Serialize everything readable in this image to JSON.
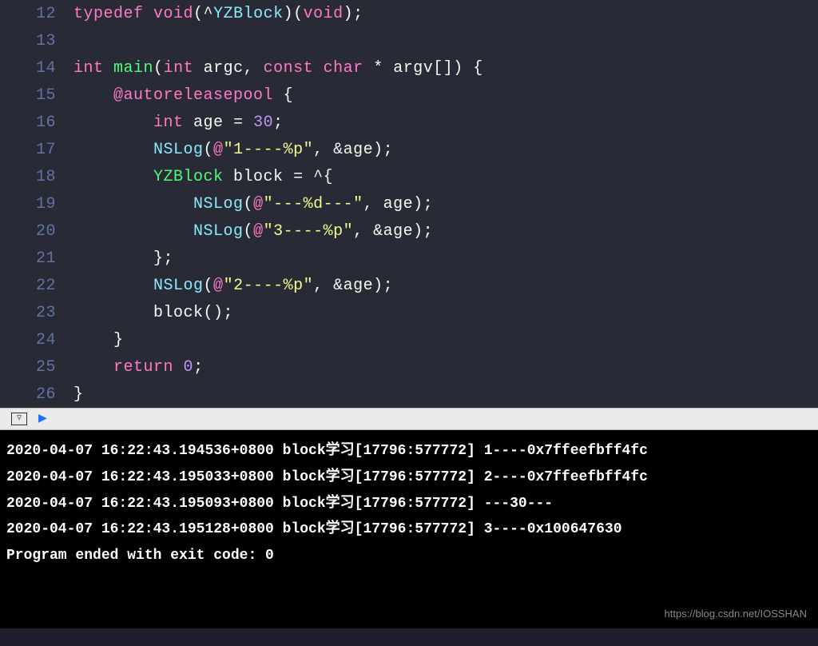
{
  "code": {
    "lines": [
      {
        "n": "12",
        "html": "<span class='kw'>typedef</span> <span class='kw'>void</span><span class='punc'>(^</span><span class='type'>YZBlock</span><span class='punc'>)(</span><span class='kw'>void</span><span class='punc'>);</span>"
      },
      {
        "n": "13",
        "html": ""
      },
      {
        "n": "14",
        "html": "<span class='kw'>int</span> <span class='fn'>main</span><span class='punc'>(</span><span class='kw'>int</span> <span class='id'>argc</span><span class='punc'>,</span> <span class='kw'>const</span> <span class='kw'>char</span> <span class='punc'>*</span> <span class='id'>argv</span><span class='punc'>[]) {</span>"
      },
      {
        "n": "15",
        "html": "    <span class='kw'>@autoreleasepool</span> <span class='punc'>{</span>"
      },
      {
        "n": "16",
        "html": "        <span class='kw'>int</span> <span class='id'>age</span> <span class='punc'>=</span> <span class='num'>30</span><span class='punc'>;</span>"
      },
      {
        "n": "17",
        "html": "        <span class='type'>NSLog</span><span class='punc'>(</span><span class='kw'>@</span><span class='str'>\"1----%p\"</span><span class='punc'>,</span> <span class='punc'>&amp;</span><span class='id'>age</span><span class='punc'>);</span>"
      },
      {
        "n": "18",
        "html": "        <span class='fn'>YZBlock</span> <span class='id'>block</span> <span class='punc'>= ^{</span>"
      },
      {
        "n": "19",
        "html": "            <span class='type'>NSLog</span><span class='punc'>(</span><span class='kw'>@</span><span class='str'>\"---%d---\"</span><span class='punc'>,</span> <span class='id'>age</span><span class='punc'>);</span>"
      },
      {
        "n": "20",
        "html": "            <span class='type'>NSLog</span><span class='punc'>(</span><span class='kw'>@</span><span class='str'>\"3----%p\"</span><span class='punc'>,</span> <span class='punc'>&amp;</span><span class='id'>age</span><span class='punc'>);</span>"
      },
      {
        "n": "21",
        "html": "        <span class='punc'>};</span>"
      },
      {
        "n": "22",
        "html": "        <span class='type'>NSLog</span><span class='punc'>(</span><span class='kw'>@</span><span class='str'>\"2----%p\"</span><span class='punc'>,</span> <span class='punc'>&amp;</span><span class='id'>age</span><span class='punc'>);</span>"
      },
      {
        "n": "23",
        "html": "        <span class='id'>block</span><span class='punc'>();</span>"
      },
      {
        "n": "24",
        "html": "    <span class='punc'>}</span>"
      },
      {
        "n": "25",
        "html": "    <span class='kw'>return</span> <span class='num'>0</span><span class='punc'>;</span>"
      },
      {
        "n": "26",
        "html": "<span class='punc'>}</span>"
      }
    ]
  },
  "toolbar": {
    "dropdown": "▽",
    "arrow": "▶"
  },
  "console": {
    "lines": [
      "2020-04-07 16:22:43.194536+0800 block学习[17796:577772] 1----0x7ffeefbff4fc",
      "2020-04-07 16:22:43.195033+0800 block学习[17796:577772] 2----0x7ffeefbff4fc",
      "2020-04-07 16:22:43.195093+0800 block学习[17796:577772] ---30---",
      "2020-04-07 16:22:43.195128+0800 block学习[17796:577772] 3----0x100647630",
      "Program ended with exit code: 0"
    ],
    "watermark": "https://blog.csdn.net/IOSSHAN"
  }
}
